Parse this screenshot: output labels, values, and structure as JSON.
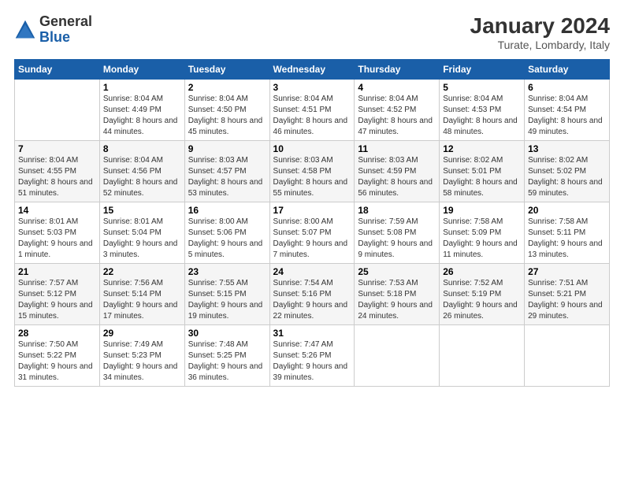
{
  "logo": {
    "general": "General",
    "blue": "Blue"
  },
  "header": {
    "month": "January 2024",
    "location": "Turate, Lombardy, Italy"
  },
  "weekdays": [
    "Sunday",
    "Monday",
    "Tuesday",
    "Wednesday",
    "Thursday",
    "Friday",
    "Saturday"
  ],
  "weeks": [
    [
      {
        "day": "",
        "sunrise": "",
        "sunset": "",
        "daylight": ""
      },
      {
        "day": "1",
        "sunrise": "Sunrise: 8:04 AM",
        "sunset": "Sunset: 4:49 PM",
        "daylight": "Daylight: 8 hours and 44 minutes."
      },
      {
        "day": "2",
        "sunrise": "Sunrise: 8:04 AM",
        "sunset": "Sunset: 4:50 PM",
        "daylight": "Daylight: 8 hours and 45 minutes."
      },
      {
        "day": "3",
        "sunrise": "Sunrise: 8:04 AM",
        "sunset": "Sunset: 4:51 PM",
        "daylight": "Daylight: 8 hours and 46 minutes."
      },
      {
        "day": "4",
        "sunrise": "Sunrise: 8:04 AM",
        "sunset": "Sunset: 4:52 PM",
        "daylight": "Daylight: 8 hours and 47 minutes."
      },
      {
        "day": "5",
        "sunrise": "Sunrise: 8:04 AM",
        "sunset": "Sunset: 4:53 PM",
        "daylight": "Daylight: 8 hours and 48 minutes."
      },
      {
        "day": "6",
        "sunrise": "Sunrise: 8:04 AM",
        "sunset": "Sunset: 4:54 PM",
        "daylight": "Daylight: 8 hours and 49 minutes."
      }
    ],
    [
      {
        "day": "7",
        "sunrise": "Sunrise: 8:04 AM",
        "sunset": "Sunset: 4:55 PM",
        "daylight": "Daylight: 8 hours and 51 minutes."
      },
      {
        "day": "8",
        "sunrise": "Sunrise: 8:04 AM",
        "sunset": "Sunset: 4:56 PM",
        "daylight": "Daylight: 8 hours and 52 minutes."
      },
      {
        "day": "9",
        "sunrise": "Sunrise: 8:03 AM",
        "sunset": "Sunset: 4:57 PM",
        "daylight": "Daylight: 8 hours and 53 minutes."
      },
      {
        "day": "10",
        "sunrise": "Sunrise: 8:03 AM",
        "sunset": "Sunset: 4:58 PM",
        "daylight": "Daylight: 8 hours and 55 minutes."
      },
      {
        "day": "11",
        "sunrise": "Sunrise: 8:03 AM",
        "sunset": "Sunset: 4:59 PM",
        "daylight": "Daylight: 8 hours and 56 minutes."
      },
      {
        "day": "12",
        "sunrise": "Sunrise: 8:02 AM",
        "sunset": "Sunset: 5:01 PM",
        "daylight": "Daylight: 8 hours and 58 minutes."
      },
      {
        "day": "13",
        "sunrise": "Sunrise: 8:02 AM",
        "sunset": "Sunset: 5:02 PM",
        "daylight": "Daylight: 8 hours and 59 minutes."
      }
    ],
    [
      {
        "day": "14",
        "sunrise": "Sunrise: 8:01 AM",
        "sunset": "Sunset: 5:03 PM",
        "daylight": "Daylight: 9 hours and 1 minute."
      },
      {
        "day": "15",
        "sunrise": "Sunrise: 8:01 AM",
        "sunset": "Sunset: 5:04 PM",
        "daylight": "Daylight: 9 hours and 3 minutes."
      },
      {
        "day": "16",
        "sunrise": "Sunrise: 8:00 AM",
        "sunset": "Sunset: 5:06 PM",
        "daylight": "Daylight: 9 hours and 5 minutes."
      },
      {
        "day": "17",
        "sunrise": "Sunrise: 8:00 AM",
        "sunset": "Sunset: 5:07 PM",
        "daylight": "Daylight: 9 hours and 7 minutes."
      },
      {
        "day": "18",
        "sunrise": "Sunrise: 7:59 AM",
        "sunset": "Sunset: 5:08 PM",
        "daylight": "Daylight: 9 hours and 9 minutes."
      },
      {
        "day": "19",
        "sunrise": "Sunrise: 7:58 AM",
        "sunset": "Sunset: 5:09 PM",
        "daylight": "Daylight: 9 hours and 11 minutes."
      },
      {
        "day": "20",
        "sunrise": "Sunrise: 7:58 AM",
        "sunset": "Sunset: 5:11 PM",
        "daylight": "Daylight: 9 hours and 13 minutes."
      }
    ],
    [
      {
        "day": "21",
        "sunrise": "Sunrise: 7:57 AM",
        "sunset": "Sunset: 5:12 PM",
        "daylight": "Daylight: 9 hours and 15 minutes."
      },
      {
        "day": "22",
        "sunrise": "Sunrise: 7:56 AM",
        "sunset": "Sunset: 5:14 PM",
        "daylight": "Daylight: 9 hours and 17 minutes."
      },
      {
        "day": "23",
        "sunrise": "Sunrise: 7:55 AM",
        "sunset": "Sunset: 5:15 PM",
        "daylight": "Daylight: 9 hours and 19 minutes."
      },
      {
        "day": "24",
        "sunrise": "Sunrise: 7:54 AM",
        "sunset": "Sunset: 5:16 PM",
        "daylight": "Daylight: 9 hours and 22 minutes."
      },
      {
        "day": "25",
        "sunrise": "Sunrise: 7:53 AM",
        "sunset": "Sunset: 5:18 PM",
        "daylight": "Daylight: 9 hours and 24 minutes."
      },
      {
        "day": "26",
        "sunrise": "Sunrise: 7:52 AM",
        "sunset": "Sunset: 5:19 PM",
        "daylight": "Daylight: 9 hours and 26 minutes."
      },
      {
        "day": "27",
        "sunrise": "Sunrise: 7:51 AM",
        "sunset": "Sunset: 5:21 PM",
        "daylight": "Daylight: 9 hours and 29 minutes."
      }
    ],
    [
      {
        "day": "28",
        "sunrise": "Sunrise: 7:50 AM",
        "sunset": "Sunset: 5:22 PM",
        "daylight": "Daylight: 9 hours and 31 minutes."
      },
      {
        "day": "29",
        "sunrise": "Sunrise: 7:49 AM",
        "sunset": "Sunset: 5:23 PM",
        "daylight": "Daylight: 9 hours and 34 minutes."
      },
      {
        "day": "30",
        "sunrise": "Sunrise: 7:48 AM",
        "sunset": "Sunset: 5:25 PM",
        "daylight": "Daylight: 9 hours and 36 minutes."
      },
      {
        "day": "31",
        "sunrise": "Sunrise: 7:47 AM",
        "sunset": "Sunset: 5:26 PM",
        "daylight": "Daylight: 9 hours and 39 minutes."
      },
      {
        "day": "",
        "sunrise": "",
        "sunset": "",
        "daylight": ""
      },
      {
        "day": "",
        "sunrise": "",
        "sunset": "",
        "daylight": ""
      },
      {
        "day": "",
        "sunrise": "",
        "sunset": "",
        "daylight": ""
      }
    ]
  ]
}
